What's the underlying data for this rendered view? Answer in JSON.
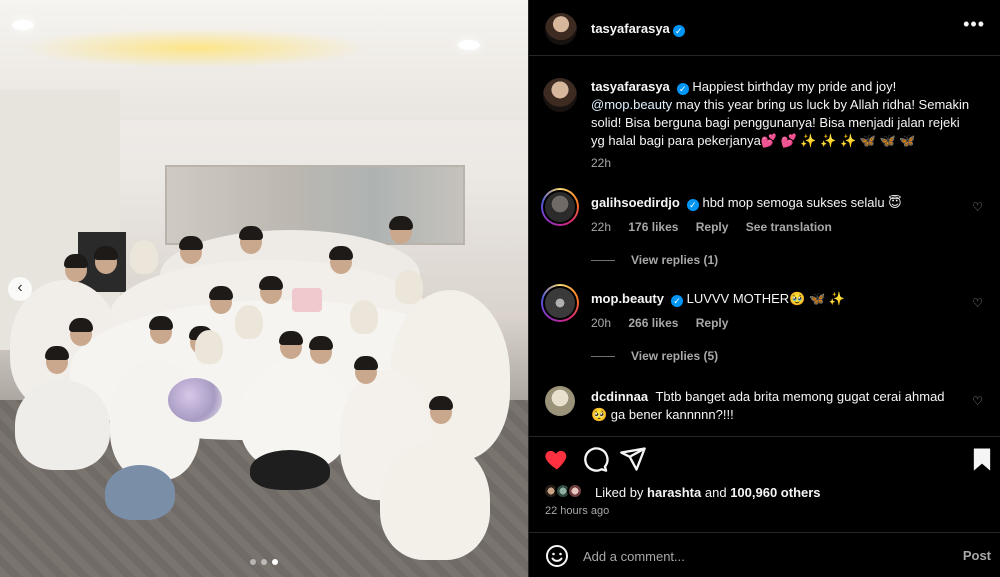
{
  "post": {
    "author": "tasyafarasya",
    "caption_author": "tasyafarasya",
    "caption_text": "Happiest birthday my pride and joy!",
    "caption_mention": "@mop.beauty",
    "caption_rest": "may this year bring us luck by Allah ridha! Semakin solid! Bisa berguna bagi penggunanya! Bisa menjadi jalan rejeki yg halal bagi para pekerjanya💕 💕 ✨ ✨ ✨ 🦋 🦋 🦋",
    "caption_time": "22h",
    "more_icon": "•••"
  },
  "comments": [
    {
      "username": "galihsoedirdjo",
      "text": "hbd mop semoga sukses selalu 😇",
      "time": "22h",
      "likes": "176 likes",
      "reply": "Reply",
      "translation": "See translation",
      "view_replies": "View replies (1)"
    },
    {
      "username": "mop.beauty",
      "text": "LUVVV MOTHER🥹 🦋 ✨",
      "time": "20h",
      "likes": "266 likes",
      "reply": "Reply",
      "view_replies": "View replies (5)"
    },
    {
      "username": "dcdinnaa",
      "text": "Tbtb banget ada brita memong gugat cerai ahmad",
      "text2": "🥺 ga bener kannnnn?!!!"
    }
  ],
  "likes": {
    "prefix": "Liked by",
    "user": "harashta",
    "middle": "and",
    "count": "100,960 others"
  },
  "time_ago": "22 hours ago",
  "add_comment": {
    "placeholder": "Add a comment...",
    "post_label": "Post",
    "emoji_icon": "☺"
  },
  "carousel": {
    "slides": 3,
    "active": 3
  },
  "colors": {
    "like_red": "#ff3040",
    "verified_blue": "#0095f6",
    "muted": "#a8a8a8"
  }
}
